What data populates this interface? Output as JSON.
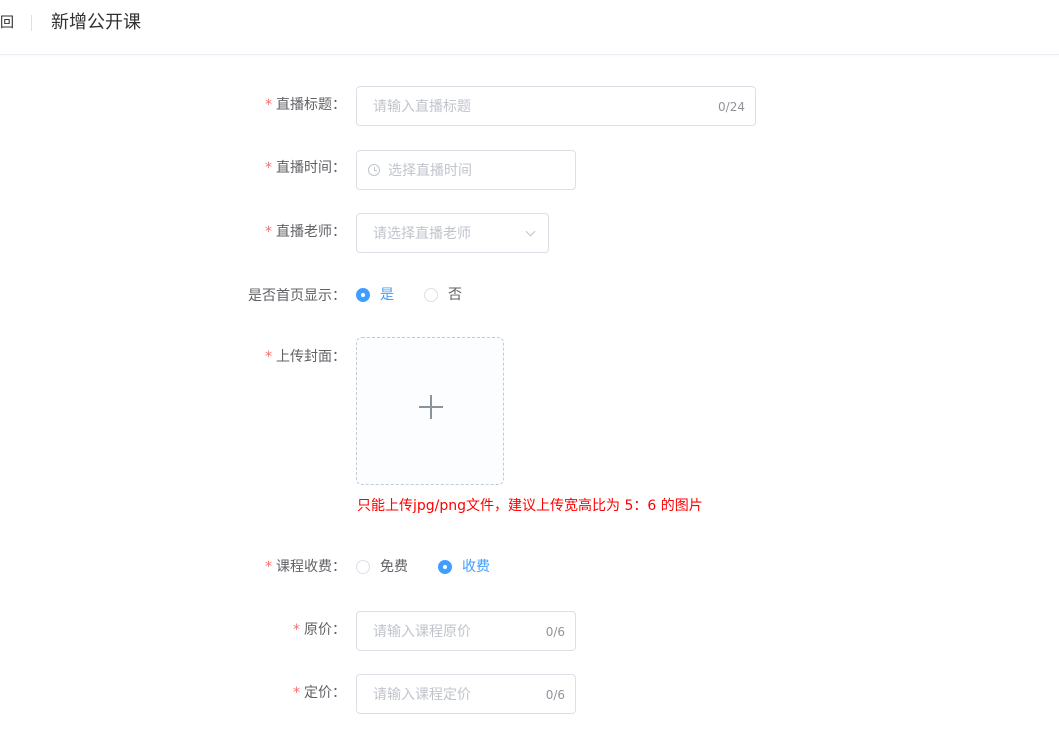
{
  "header": {
    "back_label": "回",
    "title": "新增公开课"
  },
  "form": {
    "required_mark": "*",
    "title_field": {
      "label": "直播标题：",
      "placeholder": "请输入直播标题",
      "count": "0/24"
    },
    "time_field": {
      "label": "直播时间：",
      "placeholder": "选择直播时间"
    },
    "teacher_field": {
      "label": "直播老师：",
      "placeholder": "请选择直播老师"
    },
    "homepage_field": {
      "label": "是否首页显示：",
      "options": [
        {
          "label": "是",
          "selected": true
        },
        {
          "label": "否",
          "selected": false
        }
      ]
    },
    "cover_field": {
      "label": "上传封面：",
      "tip": "只能上传jpg/png文件，建议上传宽高比为 5：6 的图片"
    },
    "fee_field": {
      "label": "课程收费：",
      "options": [
        {
          "label": "免费",
          "selected": false
        },
        {
          "label": "收费",
          "selected": true
        }
      ]
    },
    "original_price_field": {
      "label": "原价：",
      "placeholder": "请输入课程原价",
      "count": "0/6"
    },
    "price_field": {
      "label": "定价：",
      "placeholder": "请输入课程定价",
      "count": "0/6"
    }
  },
  "colors": {
    "primary": "#409eff",
    "required": "#f56c6c",
    "tip": "#ff0000",
    "border": "#dcdfe6",
    "placeholder": "#c0c4cc"
  }
}
